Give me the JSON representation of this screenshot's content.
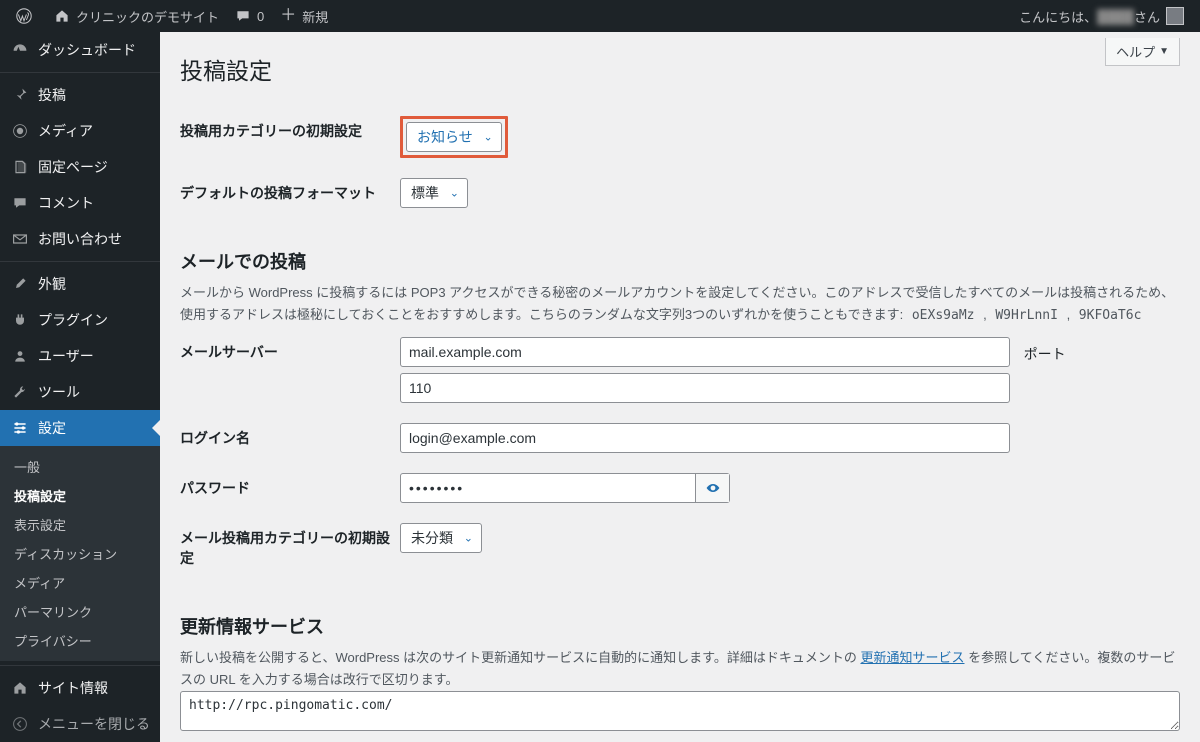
{
  "adminbar": {
    "site_title": "クリニックのデモサイト",
    "comments_count": "0",
    "new_label": "新規",
    "greeting": "こんにちは、",
    "user_display": "████",
    "suffix": "さん"
  },
  "sidebar": {
    "dashboard": "ダッシュボード",
    "posts": "投稿",
    "media": "メディア",
    "pages": "固定ページ",
    "comments": "コメント",
    "inquiries": "お問い合わせ",
    "appearance": "外観",
    "plugins": "プラグイン",
    "users": "ユーザー",
    "tools": "ツール",
    "settings": "設定",
    "sub": {
      "general": "一般",
      "writing": "投稿設定",
      "reading": "表示設定",
      "discussion": "ディスカッション",
      "media": "メディア",
      "permalink": "パーマリンク",
      "privacy": "プライバシー"
    },
    "site_info": "サイト情報",
    "collapse": "メニューを閉じる"
  },
  "help_label": "ヘルプ",
  "page_title": "投稿設定",
  "rows": {
    "default_category": {
      "label": "投稿用カテゴリーの初期設定",
      "value": "お知らせ"
    },
    "default_format": {
      "label": "デフォルトの投稿フォーマット",
      "value": "標準"
    }
  },
  "mail": {
    "heading": "メールでの投稿",
    "desc_prefix": "メールから WordPress に投稿するには POP3 アクセスができる秘密のメールアカウントを設定してください。このアドレスで受信したすべてのメールは投稿されるため、使用するアドレスは極秘にしておくことをおすすめします。こちらのランダムな文字列3つのいずれかを使うこともできます: ",
    "tokens": [
      "oEXs9aMz",
      "W9HrLnnI",
      "9KFOaT6c"
    ],
    "server_label": "メールサーバー",
    "server_value": "mail.example.com",
    "port_label": "ポート",
    "port_value": "110",
    "login_label": "ログイン名",
    "login_value": "login@example.com",
    "password_label": "パスワード",
    "password_value": "••••••••",
    "mail_category_label": "メール投稿用カテゴリーの初期設定",
    "mail_category_value": "未分類"
  },
  "update": {
    "heading": "更新情報サービス",
    "desc_before": "新しい投稿を公開すると、WordPress は次のサイト更新通知サービスに自動的に通知します。詳細はドキュメントの ",
    "link_text": "更新通知サービス",
    "desc_after": " を参照してください。複数のサービスの URL を入力する場合は改行で区切ります。",
    "textarea": "http://rpc.pingomatic.com/"
  }
}
